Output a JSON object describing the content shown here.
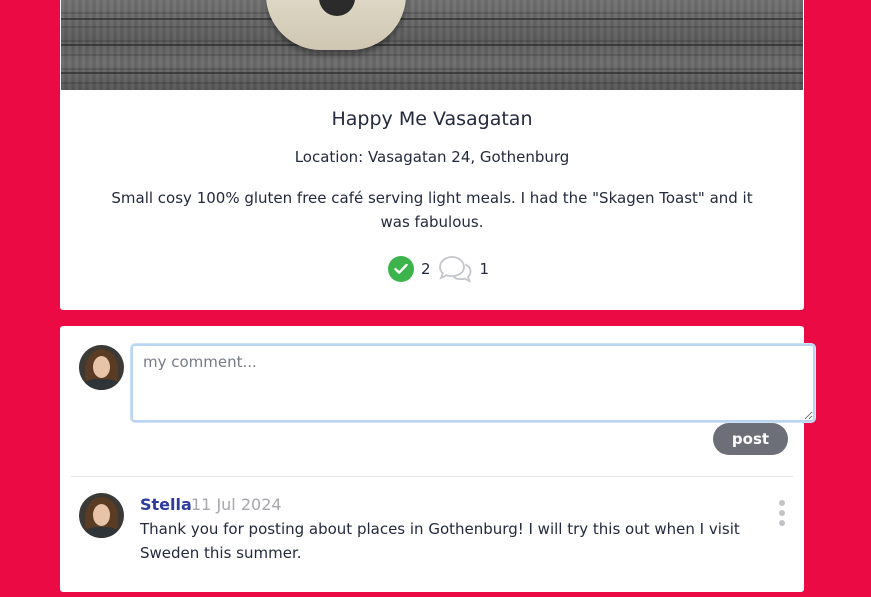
{
  "post": {
    "title": "Happy Me Vasagatan",
    "location": "Location: Vasagatan 24, Gothenburg",
    "description": "Small cosy 100% gluten free café serving light meals. I had the \"Skagen Toast\" and it was fabulous.",
    "approvals_count": "2",
    "comments_count": "1"
  },
  "comment_form": {
    "placeholder": "my comment...",
    "submit_label": "post"
  },
  "comments": [
    {
      "author": "Stella",
      "date": "11 Jul 2024",
      "text": "Thank you for posting about places in Gothenburg! I will try this out when I visit Sweden this summer."
    }
  ],
  "colors": {
    "background": "#ec0a44",
    "card": "#ffffff",
    "approve_green": "#3cb44b",
    "author_link": "#2e3b9f",
    "post_button": "#6c6f78",
    "muted_text": "#a5a7ac"
  },
  "icons": [
    "check-circle-icon",
    "comments-icon",
    "more-vertical-icon"
  ]
}
